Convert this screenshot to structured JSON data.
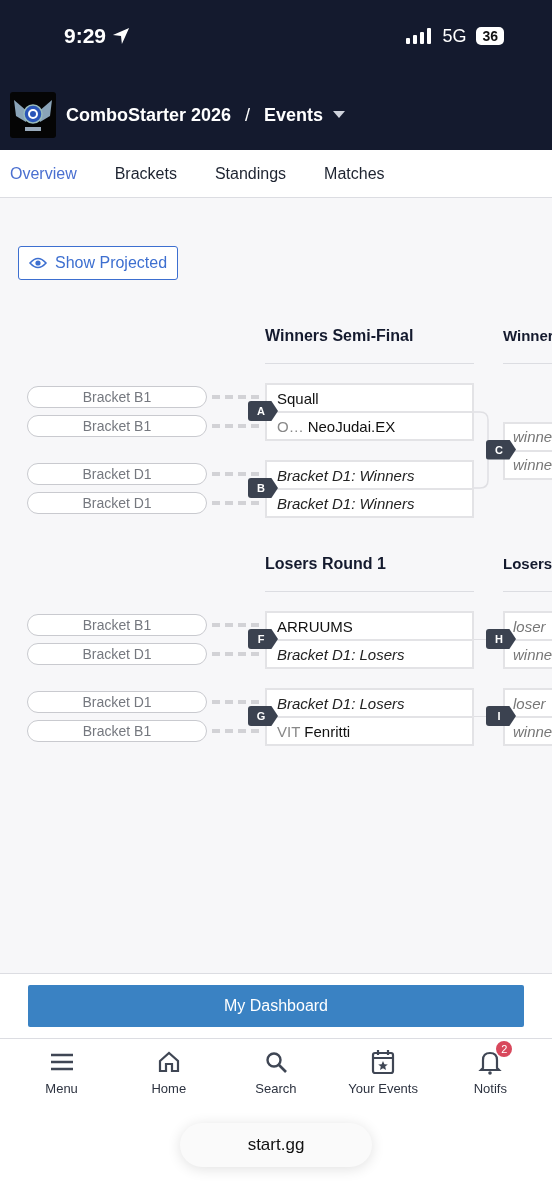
{
  "status_bar": {
    "time": "9:29",
    "network": "5G",
    "battery": "36"
  },
  "header": {
    "title": "ComboStarter 2026",
    "separator": "/",
    "section": "Events"
  },
  "tabs": [
    {
      "label": "Overview",
      "selected": true
    },
    {
      "label": "Brackets",
      "selected": false
    },
    {
      "label": "Standings",
      "selected": false
    },
    {
      "label": "Matches",
      "selected": false
    }
  ],
  "show_projected": {
    "label": "Show Projected"
  },
  "sections": [
    {
      "title": "Winners Semi-Final",
      "next_title": "Winner",
      "matches": [
        {
          "id": "A",
          "seeds": [
            "Bracket B1",
            "Bracket B1"
          ],
          "slots": [
            {
              "kind": "player",
              "name": "Squall"
            },
            {
              "kind": "player",
              "prefix": "O…",
              "name": "NeoJudai.EX"
            }
          ]
        },
        {
          "id": "B",
          "seeds": [
            "Bracket D1",
            "Bracket D1"
          ],
          "slots": [
            {
              "kind": "placeholder",
              "name": "Bracket D1: Winners"
            },
            {
              "kind": "placeholder",
              "name": "Bracket D1: Winners"
            }
          ]
        }
      ],
      "next_matches": [
        {
          "id": "C",
          "slots": [
            {
              "kind": "placeholder",
              "name": "winne"
            },
            {
              "kind": "placeholder",
              "name": "winne"
            }
          ]
        }
      ]
    },
    {
      "title": "Losers Round 1",
      "next_title": "Losers",
      "matches": [
        {
          "id": "F",
          "seeds": [
            "Bracket B1",
            "Bracket D1"
          ],
          "slots": [
            {
              "kind": "player",
              "name": "ARRUUMS"
            },
            {
              "kind": "placeholder",
              "name": "Bracket D1: Losers"
            }
          ]
        },
        {
          "id": "G",
          "seeds": [
            "Bracket D1",
            "Bracket B1"
          ],
          "slots": [
            {
              "kind": "placeholder",
              "name": "Bracket D1: Losers"
            },
            {
              "kind": "player",
              "prefix": "VIT",
              "name": "Fenritti"
            }
          ]
        }
      ],
      "next_matches": [
        {
          "id": "H",
          "slots": [
            {
              "kind": "placeholder",
              "name": "loser"
            },
            {
              "kind": "placeholder",
              "name": "winne"
            }
          ]
        },
        {
          "id": "I",
          "slots": [
            {
              "kind": "placeholder",
              "name": "loser"
            },
            {
              "kind": "placeholder",
              "name": "winne"
            }
          ]
        }
      ]
    }
  ],
  "dashboard_button": "My Dashboard",
  "nav": [
    {
      "kind": "menu",
      "label": "Menu"
    },
    {
      "kind": "home",
      "label": "Home"
    },
    {
      "kind": "search",
      "label": "Search"
    },
    {
      "kind": "events",
      "label": "Your Events"
    },
    {
      "kind": "bell",
      "label": "Notifs",
      "badge": "2"
    }
  ],
  "url": "start.gg"
}
